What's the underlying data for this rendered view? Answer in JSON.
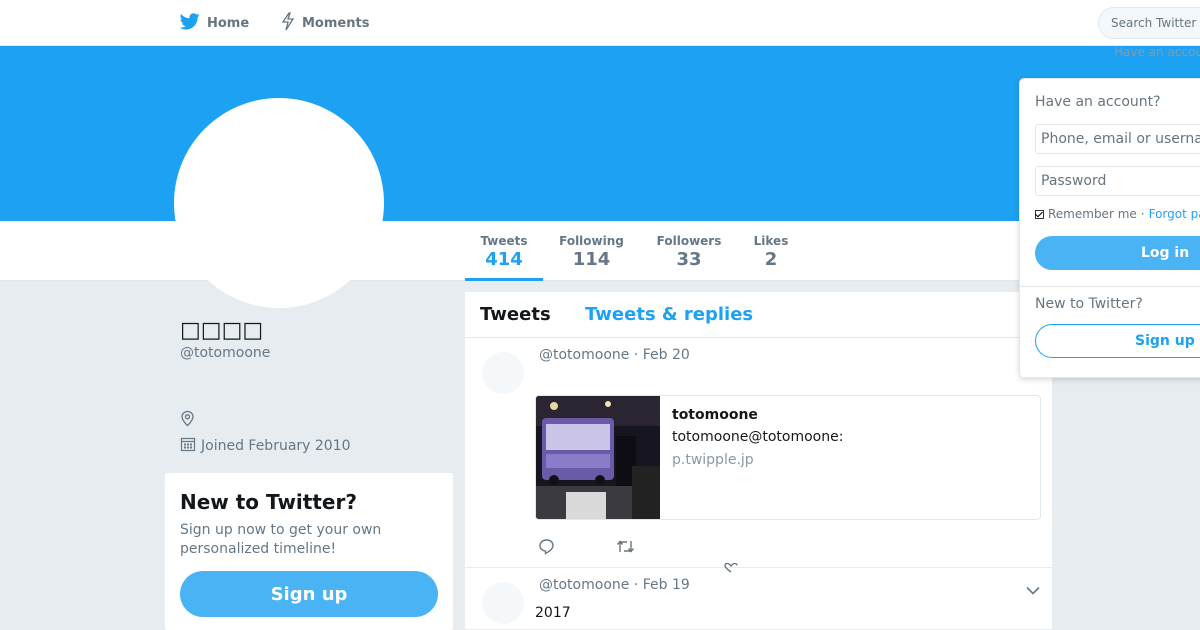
{
  "nav": {
    "home_label": "Home",
    "moments_label": "Moments",
    "search_placeholder": "Search Twitter",
    "have_account_text": "Have an accou"
  },
  "profile": {
    "name": "□□□□",
    "handle": "@totomoone",
    "joined": "Joined February 2010"
  },
  "stats": [
    {
      "label": "Tweets",
      "value": "414",
      "active": true
    },
    {
      "label": "Following",
      "value": "114",
      "active": false
    },
    {
      "label": "Followers",
      "value": "33",
      "active": false
    },
    {
      "label": "Likes",
      "value": "2",
      "active": false
    }
  ],
  "signup_card": {
    "title": "New to Twitter?",
    "description": "Sign up now to get your own personalized timeline!",
    "button": "Sign up"
  },
  "timeline": {
    "tabs": [
      "Tweets",
      "Tweets & replies"
    ],
    "tweets": [
      {
        "header": "@totomoone · Feb 20",
        "text": "",
        "card": {
          "title": "totomoone",
          "description": "totomoone@totomoone:",
          "url": "p.twipple.jp"
        }
      },
      {
        "header": "@totomoone · Feb 19",
        "text": "2017"
      }
    ]
  },
  "login": {
    "title": "Have an account?",
    "phone_placeholder": "Phone, email or username",
    "password_placeholder": "Password",
    "remember": "Remember me",
    "separator": "·",
    "forgot": "Forgot password?",
    "login_button": "Log in",
    "new_to_twitter": "New to Twitter?",
    "signup_button": "Sign up"
  },
  "colors": {
    "brand": "#1da1f2",
    "button": "#4ab3f4",
    "background": "#e6ecf0"
  }
}
